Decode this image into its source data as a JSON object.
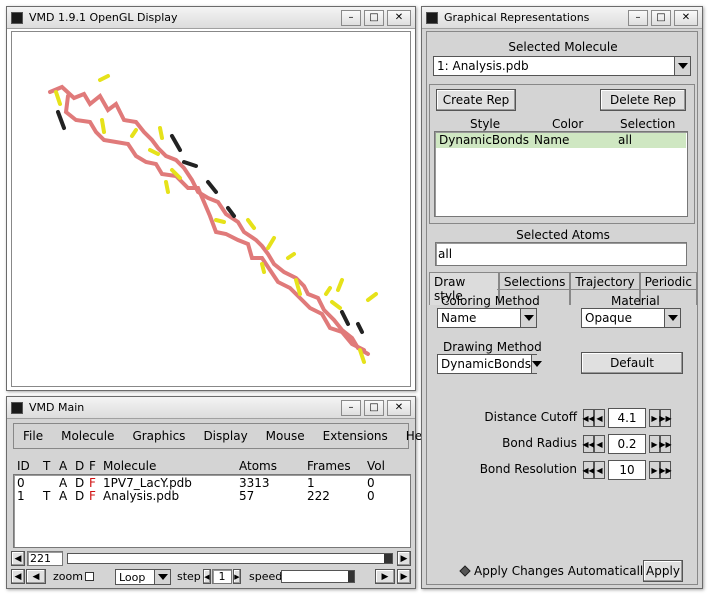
{
  "display_window": {
    "title": "VMD 1.9.1 OpenGL Display"
  },
  "main_window": {
    "title": "VMD Main",
    "menu": [
      "File",
      "Molecule",
      "Graphics",
      "Display",
      "Mouse",
      "Extensions",
      "Help"
    ],
    "table_headers": {
      "id": "ID",
      "t": "T",
      "a": "A",
      "d": "D",
      "f": "F",
      "molecule": "Molecule",
      "atoms": "Atoms",
      "frames": "Frames",
      "vol": "Vol"
    },
    "rows": [
      {
        "id": "0",
        "t": "",
        "a": "A",
        "d": "D",
        "f": "F",
        "molecule": "1PV7_LacY.pdb",
        "atoms": "3313",
        "frames": "1",
        "vol": "0"
      },
      {
        "id": "1",
        "t": "T",
        "a": "A",
        "d": "D",
        "f": "F",
        "molecule": "Analysis.pdb",
        "atoms": "57",
        "frames": "222",
        "vol": "0"
      }
    ],
    "frame_value": "221",
    "zoom_label": "zoom",
    "loop_value": "Loop",
    "step_label": "step",
    "step_value": "1",
    "speed_label": "speed"
  },
  "reps_window": {
    "title": "Graphical Representations",
    "selected_molecule_label": "Selected Molecule",
    "selected_molecule": "1: Analysis.pdb",
    "create_rep": "Create Rep",
    "delete_rep": "Delete Rep",
    "col_style": "Style",
    "col_color": "Color",
    "col_selection": "Selection",
    "rep_row": {
      "style": "DynamicBonds",
      "color": "Name",
      "selection": "all"
    },
    "selected_atoms_label": "Selected Atoms",
    "selected_atoms": "all",
    "tabs": [
      "Draw style",
      "Selections",
      "Trajectory",
      "Periodic"
    ],
    "coloring_method_label": "Coloring Method",
    "coloring_method": "Name",
    "material_label": "Material",
    "material": "Opaque",
    "drawing_method_label": "Drawing Method",
    "drawing_method": "DynamicBonds",
    "default_button": "Default",
    "distance_cutoff_label": "Distance Cutoff",
    "distance_cutoff": "4.1",
    "bond_radius_label": "Bond Radius",
    "bond_radius": "0.2",
    "bond_resolution_label": "Bond Resolution",
    "bond_resolution": "10",
    "apply_auto_label": "Apply Changes Automatically",
    "apply_button": "Apply"
  },
  "colors": {
    "bond_pink": "#e07a7a",
    "bond_yellow": "#e6e21a",
    "bond_dark": "#222222",
    "row_highlight": "#cfe7c2",
    "flag_red": "#d01010"
  }
}
